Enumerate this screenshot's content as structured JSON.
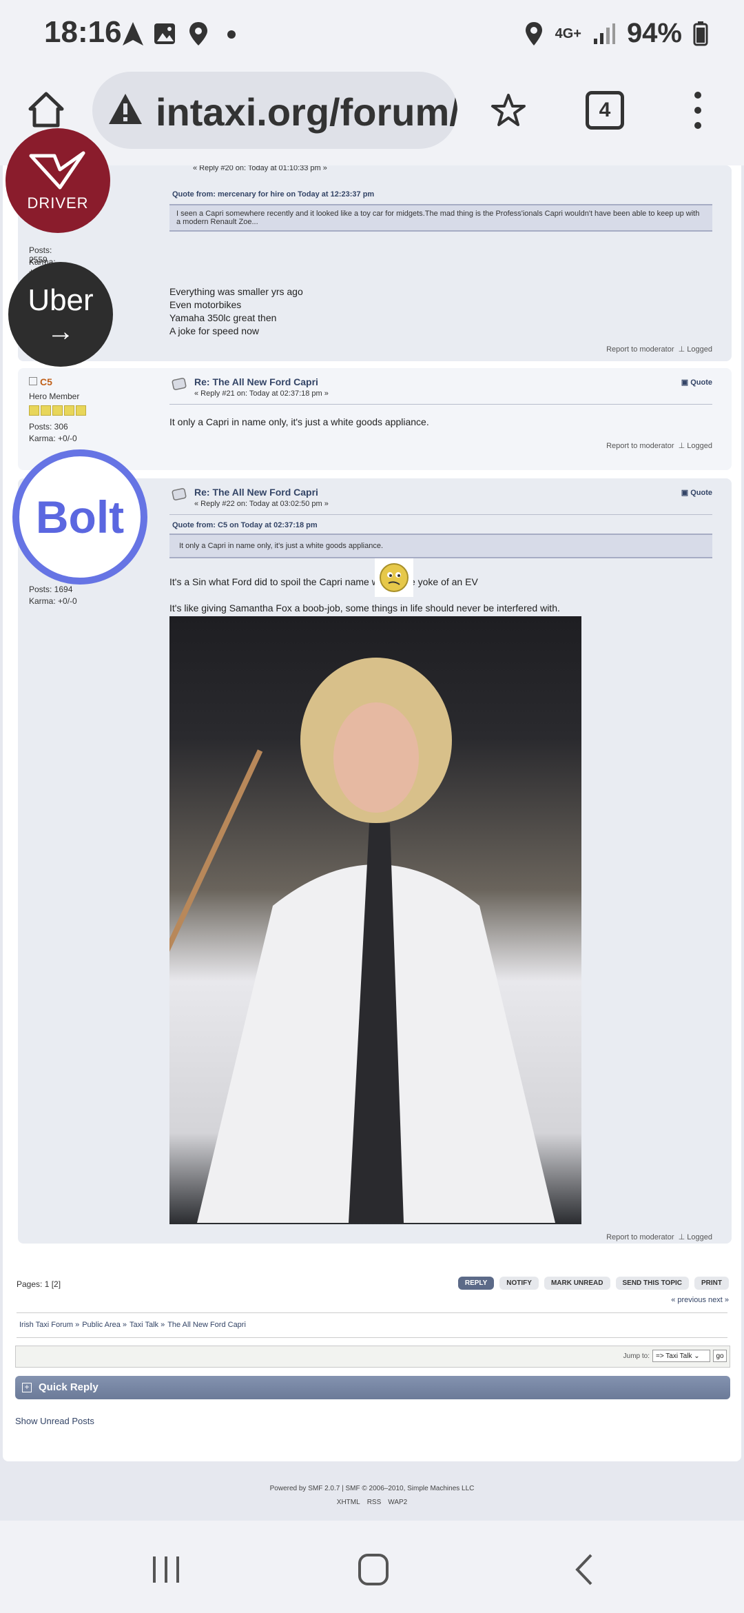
{
  "status": {
    "time": "18:16",
    "network": "4G+",
    "battery": "94%"
  },
  "browser": {
    "url": "intaxi.org/forum/ir",
    "tab_count": "4"
  },
  "overlays": {
    "driver_label": "DRIVER",
    "uber_label": "Uber",
    "uber_arrow": "→",
    "bolt_label": "Bolt"
  },
  "post1": {
    "reply_line": "« Reply #20 on: Today at 01:10:33 pm »",
    "quote_from": "Quote from: mercenary for hire on Today at 12:23:37 pm",
    "quote_text": "I seen a Capri somewhere recently and it looked like a toy car for midgets.The mad thing is the Profess'ionals Capri wouldn't have been able to keep up with a modern Renault Zoe...",
    "posts": "Posts: 2559",
    "karma": "Karma: +0/-0",
    "lines": [
      "Everything was smaller yrs ago",
      "Even motorbikes",
      "Yamaha 350lc great then",
      "A joke for speed now"
    ],
    "report": "Report to moderator",
    "logged": "Logged"
  },
  "post2": {
    "username": "C5",
    "rank": "Hero Member",
    "posts": "Posts: 306",
    "karma": "Karma: +0/-0",
    "subject": "Re: The All New Ford Capri",
    "reply_line": "« Reply #21 on: Today at 02:37:18 pm »",
    "quote_label": "Quote",
    "text": "It only a Capri in name only, it's just a white goods appliance.",
    "report": "Report to moderator",
    "logged": "Logged"
  },
  "post3": {
    "subject": "Re: The All New Ford Capri",
    "reply_line": "« Reply #22 on: Today at 03:02:50 pm »",
    "quote_label": "Quote",
    "quote_from": "Quote from: C5 on Today at 02:37:18 pm",
    "quote_text": "It only a Capri in name only, it's just a white goods appliance.",
    "posts": "Posts: 1694",
    "karma": "Karma: +0/-0",
    "text1": "It's a Sin what Ford did to spoil the Capri name with some yoke of an EV",
    "text2": "It's like giving Samantha Fox a boob-job, some things in life should never be interfered with.",
    "report": "Report to moderator",
    "logged": "Logged"
  },
  "pager": {
    "label": "Pages: 1 [2]",
    "prev_next": "« previous next »"
  },
  "actions": {
    "reply": "REPLY",
    "notify": "NOTIFY",
    "mark_unread": "MARK UNREAD",
    "send_topic": "SEND THIS TOPIC",
    "print": "PRINT"
  },
  "breadcrumb": [
    "Irish Taxi Forum »",
    "Public Area »",
    "Taxi Talk »",
    "The All New Ford Capri"
  ],
  "jump": {
    "label": "Jump to:",
    "value": "=> Taxi Talk",
    "go": "go"
  },
  "quick_reply": "Quick Reply",
  "unread": "Show Unread Posts",
  "footer": {
    "powered": "Powered by SMF 2.0.7 | SMF © 2006–2010, Simple Machines LLC",
    "links": [
      "XHTML",
      "RSS",
      "WAP2"
    ]
  },
  "colors": {
    "accent": "#5c6a88",
    "driver_bg": "#8a1c2c",
    "uber_bg": "#2d2d2d",
    "bolt_ring": "#6674e4",
    "bolt_fill": "#5b67e0"
  }
}
